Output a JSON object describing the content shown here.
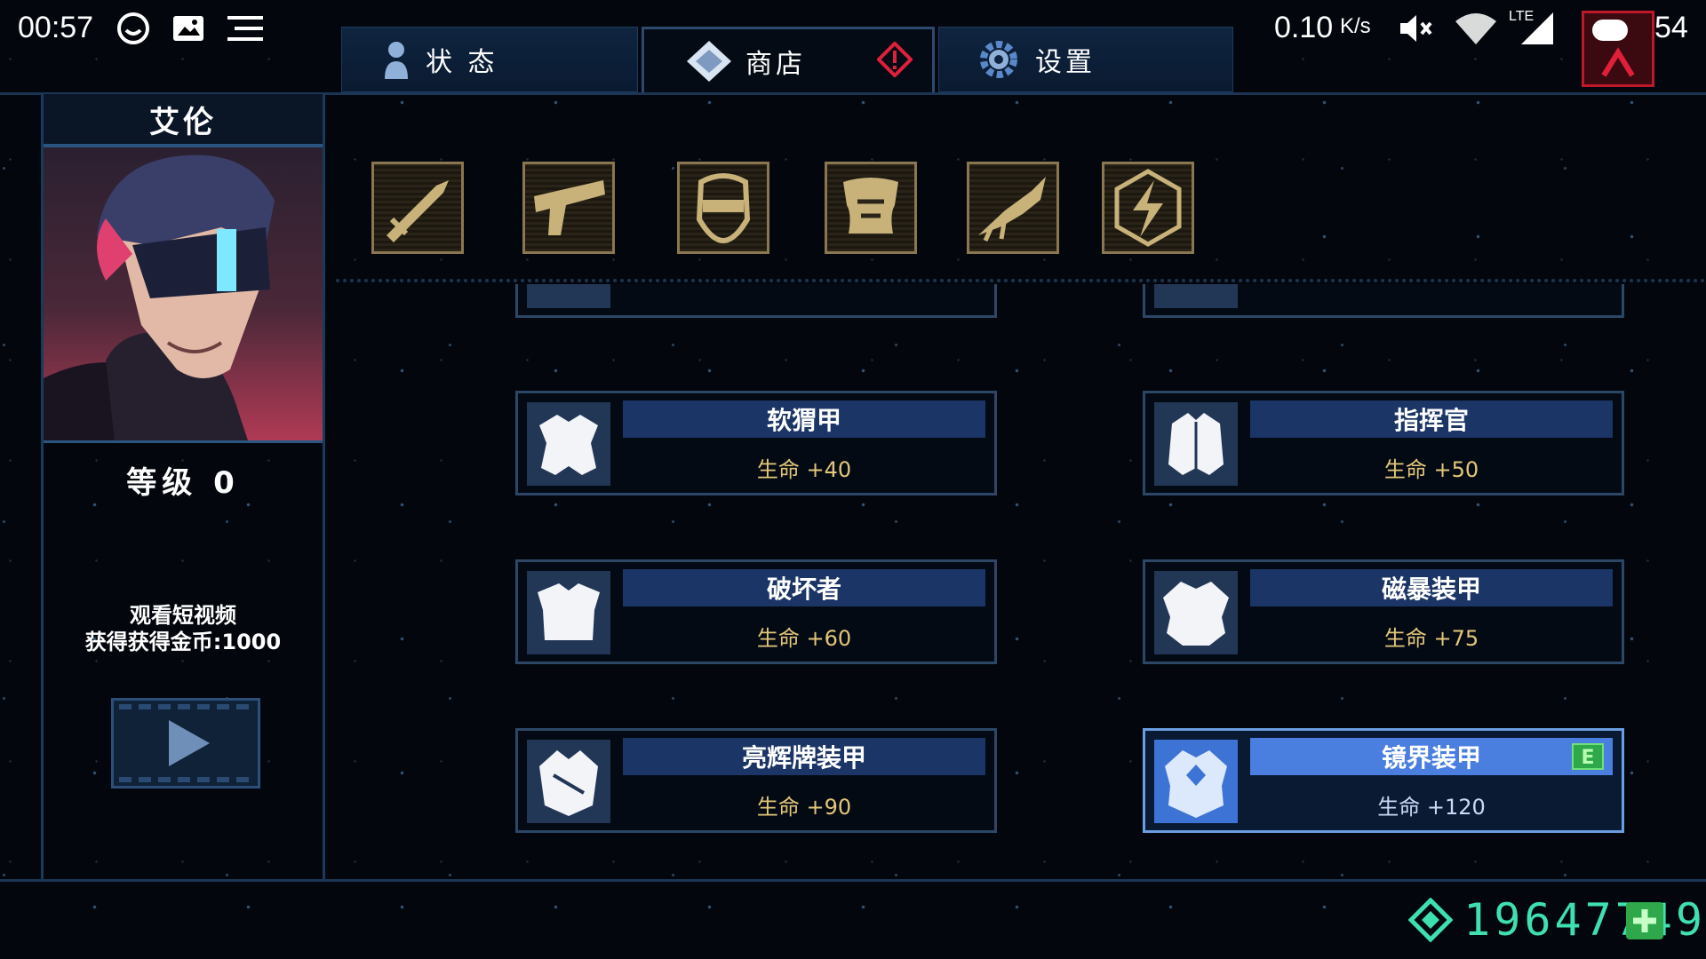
{
  "status_bar": {
    "time": "00:57",
    "speed_value": "0.10",
    "speed_unit": "K/s",
    "network": "LTE",
    "battery": "54"
  },
  "tabs": [
    {
      "label": "状 态",
      "icon": "person-icon",
      "active": false
    },
    {
      "label": "商店",
      "icon": "diamond-icon",
      "active": true
    },
    {
      "label": "设置",
      "icon": "gear-icon",
      "active": false
    }
  ],
  "character": {
    "name": "艾伦",
    "level": "等级 0",
    "reward_line1": "观看短视频",
    "reward_line2": "获得获得金币:1000"
  },
  "categories": [
    {
      "icon": "sword-icon"
    },
    {
      "icon": "gun-icon"
    },
    {
      "icon": "helmet-icon"
    },
    {
      "icon": "armor-icon"
    },
    {
      "icon": "claw-icon"
    },
    {
      "icon": "lightning-icon"
    }
  ],
  "items": [
    {
      "name": "软猬甲",
      "stat": "生命 +40",
      "selected": false
    },
    {
      "name": "指挥官",
      "stat": "生命 +50",
      "selected": false
    },
    {
      "name": "破坏者",
      "stat": "生命 +60",
      "selected": false
    },
    {
      "name": "磁暴装甲",
      "stat": "生命 +75",
      "selected": false
    },
    {
      "name": "亮辉牌装甲",
      "stat": "生命 +90",
      "selected": false
    },
    {
      "name": "镜界装甲",
      "stat": "生命 +120",
      "selected": true,
      "badge": "E"
    }
  ],
  "currency": {
    "amount": "19647749"
  },
  "colors": {
    "accent": "#4a7fe0",
    "stat_gold": "#e2c679",
    "currency_teal": "#3fe0b0",
    "alert_red": "#e0203a"
  }
}
